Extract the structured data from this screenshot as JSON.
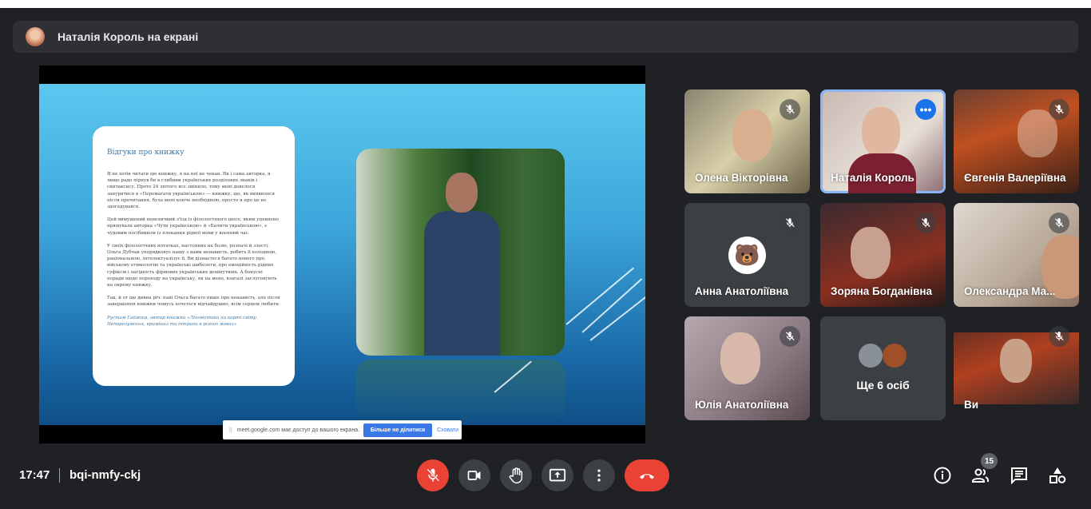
{
  "header": {
    "presenter_text": "Наталія Король на екрані"
  },
  "slide": {
    "title": "Відгуки про книжку",
    "paragraphs": [
      "Я не хотів читати цю книжку, я на неї не чекав. Як і сама авторка, я лише радо пірнув би в глибини українських розділових знаків і синтаксису. Проте 24 лютого все змінило, тому мені довелося зануритися в «Перемагати українською» — книжку, що, як виявилося після прочитання, була мені конче необхідною, просто я про це не здогадувався.",
      "Цей вимушений невеличкий з'їзд із філологічного шосе, яким упевнено прямувала авторка «Чути українською» й «Бачити українською», є чудовим посібником із плекання рідної мови у воєнний час.",
      "У своїх філологічних нотатках, настояних на болю, розпачі й злості, Ольга Дубчак упорядковує нашу з вами ненависть, робить її холодною, раціональною, інтелектуалізує її. Ви дізнаєтеся багато нового про військову етимологію та українські шиболети, про емоційність рідних суфіксів і лагідність фірмових українських демінутивів. А бонусні поради щодо переходу на українську, як на мене, взагалі заслуговують на окрему книжку.",
      "Так, й от ще дивна річ: пані Ольга багато пише про ненависть, але після завершення книжки чомусь хочеться відчайдушно, всім серцем любити."
    ],
    "signature": "Рустам Гаджієв, автор книжки «Лінгвістика на карті світу. Непорозуміння, кримінал та інтриги в різних мовах»"
  },
  "share_bar": {
    "message": "meet.google.com має доступ до вашого екрана.",
    "stop_label": "Більше не ділитися",
    "hide_label": "Сховати"
  },
  "participants": [
    {
      "name": "Олена Вікторівна",
      "muted": true
    },
    {
      "name": "Наталія Король",
      "muted": false,
      "active": true
    },
    {
      "name": "Євгенія Валеріївна",
      "muted": true
    },
    {
      "name": "Анна Анатоліївна",
      "muted": true
    },
    {
      "name": "Зоряна Богданівна",
      "muted": true
    },
    {
      "name": "Олександра Ма...",
      "muted": true
    },
    {
      "name": "Юлія Анатоліївна",
      "muted": true
    },
    {
      "name": "Ще 6 осіб"
    },
    {
      "name": "Ви",
      "muted": true
    }
  ],
  "footer": {
    "time": "17:47",
    "meeting_code": "bqi-nmfy-ckj",
    "participant_count": "15"
  },
  "colors": {
    "end_call": "#ea4335",
    "mic_off": "#ea4335",
    "accent": "#1a73e8",
    "background": "#202124"
  }
}
